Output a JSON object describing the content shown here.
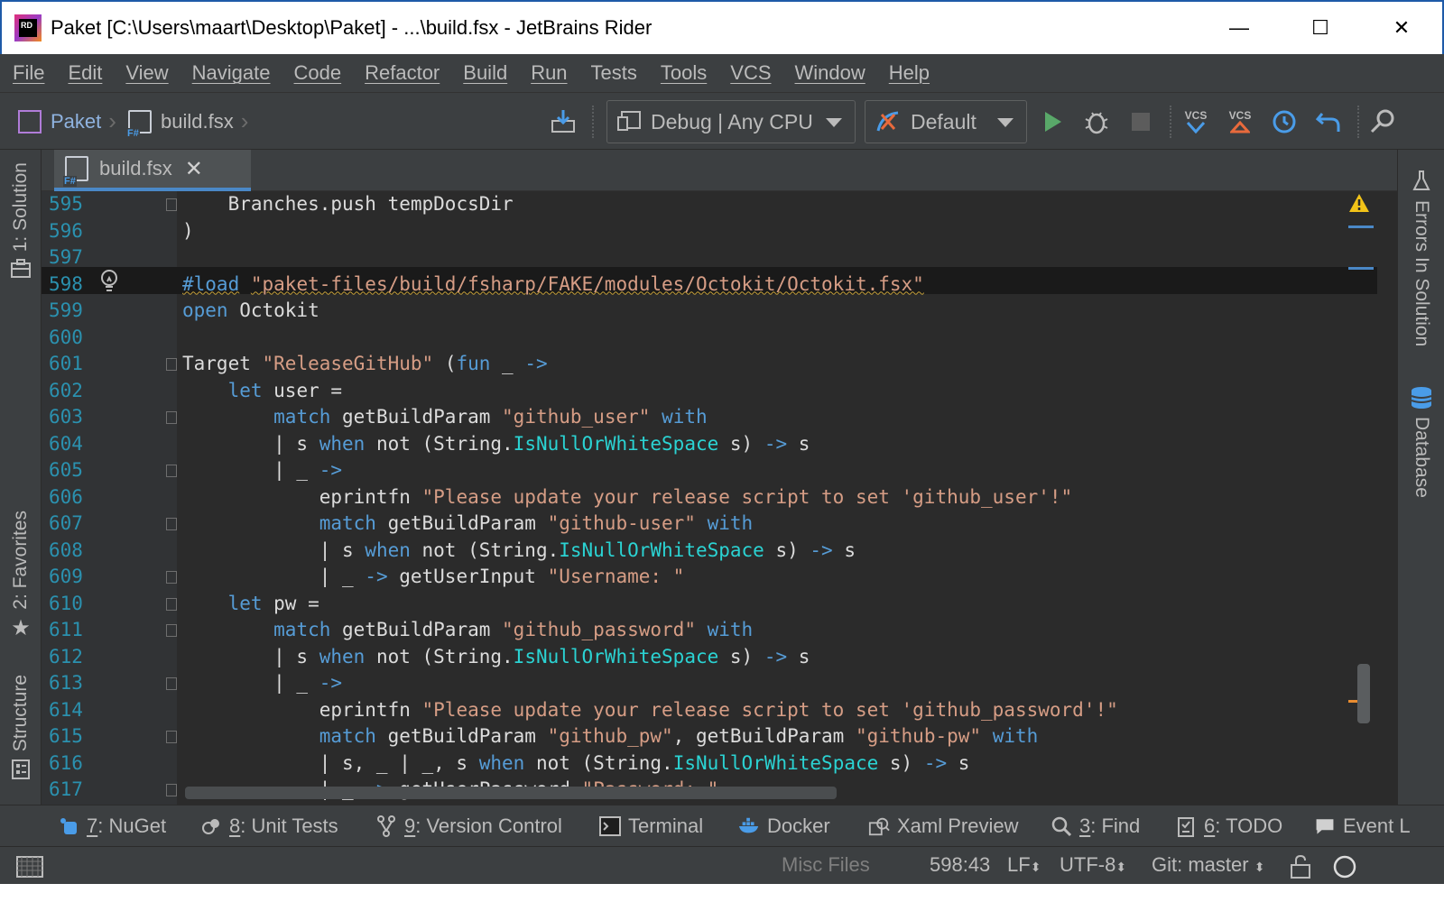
{
  "window": {
    "title": "Paket [C:\\Users\\maart\\Desktop\\Paket] - ...\\build.fsx - JetBrains Rider",
    "logo_text": "RD",
    "minimize": "—",
    "maximize": "☐",
    "close": "✕"
  },
  "menu": [
    "File",
    "Edit",
    "View",
    "Navigate",
    "Code",
    "Refactor",
    "Build",
    "Run",
    "Tests",
    "Tools",
    "VCS",
    "Window",
    "Help"
  ],
  "breadcrumb": {
    "project": "Paket",
    "file": "build.fsx",
    "sep": "›"
  },
  "toolbar": {
    "config": "Debug | Any CPU",
    "run_config": "Default",
    "vcs_update_label": "VCS",
    "vcs_commit_label": "VCS"
  },
  "left_tools": {
    "solution": "1: Solution",
    "favorites": "2: Favorites",
    "structure": "Structure"
  },
  "right_tools": {
    "errors": "Errors In Solution",
    "database": "Database"
  },
  "tab": {
    "label": "build.fsx",
    "close": "✕"
  },
  "editor": {
    "lines": [
      {
        "n": "595",
        "tokens": [
          {
            "t": "    ",
            "c": "pl"
          },
          {
            "t": "Branches.push tempDocsDir",
            "c": "pl"
          }
        ]
      },
      {
        "n": "596",
        "tokens": [
          {
            "t": ")",
            "c": "pl"
          }
        ]
      },
      {
        "n": "597",
        "tokens": []
      },
      {
        "n": "598",
        "tokens": [
          {
            "t": "#load",
            "c": "dir"
          },
          {
            "t": " ",
            "c": "pl"
          },
          {
            "t": "\"paket-files/build/fsharp/FAKE/modules/Octokit/Octokit.fsx\"",
            "c": "dirstr"
          }
        ]
      },
      {
        "n": "599",
        "tokens": [
          {
            "t": "open",
            "c": "kw"
          },
          {
            "t": " Octokit",
            "c": "pl"
          }
        ]
      },
      {
        "n": "600",
        "tokens": []
      },
      {
        "n": "601",
        "tokens": [
          {
            "t": "Target ",
            "c": "pl"
          },
          {
            "t": "\"ReleaseGitHub\"",
            "c": "str"
          },
          {
            "t": " (",
            "c": "pl"
          },
          {
            "t": "fun",
            "c": "kw"
          },
          {
            "t": " _ ",
            "c": "pl"
          },
          {
            "t": "->",
            "c": "kw"
          }
        ]
      },
      {
        "n": "602",
        "tokens": [
          {
            "t": "    ",
            "c": "pl"
          },
          {
            "t": "let",
            "c": "kw"
          },
          {
            "t": " user =",
            "c": "pl"
          }
        ]
      },
      {
        "n": "603",
        "tokens": [
          {
            "t": "        ",
            "c": "pl"
          },
          {
            "t": "match",
            "c": "kw"
          },
          {
            "t": " getBuildParam ",
            "c": "pl"
          },
          {
            "t": "\"github_user\"",
            "c": "str"
          },
          {
            "t": " ",
            "c": "pl"
          },
          {
            "t": "with",
            "c": "kw"
          }
        ]
      },
      {
        "n": "604",
        "tokens": [
          {
            "t": "        | s ",
            "c": "pl"
          },
          {
            "t": "when",
            "c": "kw"
          },
          {
            "t": " not (String.",
            "c": "pl"
          },
          {
            "t": "IsNullOrWhiteSpace",
            "c": "typ"
          },
          {
            "t": " s) ",
            "c": "pl"
          },
          {
            "t": "->",
            "c": "kw"
          },
          {
            "t": " s",
            "c": "pl"
          }
        ]
      },
      {
        "n": "605",
        "tokens": [
          {
            "t": "        | _ ",
            "c": "pl"
          },
          {
            "t": "->",
            "c": "kw"
          }
        ]
      },
      {
        "n": "606",
        "tokens": [
          {
            "t": "            eprintfn ",
            "c": "pl"
          },
          {
            "t": "\"Please update your release script to set 'github_user'!\"",
            "c": "str"
          }
        ]
      },
      {
        "n": "607",
        "tokens": [
          {
            "t": "            ",
            "c": "pl"
          },
          {
            "t": "match",
            "c": "kw"
          },
          {
            "t": " getBuildParam ",
            "c": "pl"
          },
          {
            "t": "\"github-user\"",
            "c": "str"
          },
          {
            "t": " ",
            "c": "pl"
          },
          {
            "t": "with",
            "c": "kw"
          }
        ]
      },
      {
        "n": "608",
        "tokens": [
          {
            "t": "            | s ",
            "c": "pl"
          },
          {
            "t": "when",
            "c": "kw"
          },
          {
            "t": " not (String.",
            "c": "pl"
          },
          {
            "t": "IsNullOrWhiteSpace",
            "c": "typ"
          },
          {
            "t": " s) ",
            "c": "pl"
          },
          {
            "t": "->",
            "c": "kw"
          },
          {
            "t": " s",
            "c": "pl"
          }
        ]
      },
      {
        "n": "609",
        "tokens": [
          {
            "t": "            | _ ",
            "c": "pl"
          },
          {
            "t": "->",
            "c": "kw"
          },
          {
            "t": " getUserInput ",
            "c": "pl"
          },
          {
            "t": "\"Username: \"",
            "c": "str"
          }
        ]
      },
      {
        "n": "610",
        "tokens": [
          {
            "t": "    ",
            "c": "pl"
          },
          {
            "t": "let",
            "c": "kw"
          },
          {
            "t": " pw =",
            "c": "pl"
          }
        ]
      },
      {
        "n": "611",
        "tokens": [
          {
            "t": "        ",
            "c": "pl"
          },
          {
            "t": "match",
            "c": "kw"
          },
          {
            "t": " getBuildParam ",
            "c": "pl"
          },
          {
            "t": "\"github_password\"",
            "c": "str"
          },
          {
            "t": " ",
            "c": "pl"
          },
          {
            "t": "with",
            "c": "kw"
          }
        ]
      },
      {
        "n": "612",
        "tokens": [
          {
            "t": "        | s ",
            "c": "pl"
          },
          {
            "t": "when",
            "c": "kw"
          },
          {
            "t": " not (String.",
            "c": "pl"
          },
          {
            "t": "IsNullOrWhiteSpace",
            "c": "typ"
          },
          {
            "t": " s) ",
            "c": "pl"
          },
          {
            "t": "->",
            "c": "kw"
          },
          {
            "t": " s",
            "c": "pl"
          }
        ]
      },
      {
        "n": "613",
        "tokens": [
          {
            "t": "        | _ ",
            "c": "pl"
          },
          {
            "t": "->",
            "c": "kw"
          }
        ]
      },
      {
        "n": "614",
        "tokens": [
          {
            "t": "            eprintfn ",
            "c": "pl"
          },
          {
            "t": "\"Please update your release script to set 'github_password'!\"",
            "c": "str"
          }
        ]
      },
      {
        "n": "615",
        "tokens": [
          {
            "t": "            ",
            "c": "pl"
          },
          {
            "t": "match",
            "c": "kw"
          },
          {
            "t": " getBuildParam ",
            "c": "pl"
          },
          {
            "t": "\"github_pw\"",
            "c": "str"
          },
          {
            "t": ", getBuildParam ",
            "c": "pl"
          },
          {
            "t": "\"github-pw\"",
            "c": "str"
          },
          {
            "t": " ",
            "c": "pl"
          },
          {
            "t": "with",
            "c": "kw"
          }
        ]
      },
      {
        "n": "616",
        "tokens": [
          {
            "t": "            | s, _ | _, s ",
            "c": "pl"
          },
          {
            "t": "when",
            "c": "kw"
          },
          {
            "t": " not (String.",
            "c": "pl"
          },
          {
            "t": "IsNullOrWhiteSpace",
            "c": "typ"
          },
          {
            "t": " s) ",
            "c": "pl"
          },
          {
            "t": "->",
            "c": "kw"
          },
          {
            "t": " s",
            "c": "pl"
          }
        ]
      },
      {
        "n": "617",
        "tokens": [
          {
            "t": "            | _ ",
            "c": "pl"
          },
          {
            "t": "->",
            "c": "kw"
          },
          {
            "t": " getUserPassword ",
            "c": "pl"
          },
          {
            "t": "\"Password: \"",
            "c": "str"
          }
        ]
      }
    ]
  },
  "bottom_tools": [
    {
      "key": "7",
      "label": ": NuGet",
      "icon": "nuget-icon"
    },
    {
      "key": "8",
      "label": ": Unit Tests",
      "icon": "unit-tests-icon"
    },
    {
      "key": "9",
      "label": ": Version Control",
      "icon": "version-control-icon"
    },
    {
      "key": "",
      "label": "Terminal",
      "icon": "terminal-icon"
    },
    {
      "key": "",
      "label": "Docker",
      "icon": "docker-icon"
    },
    {
      "key": "",
      "label": "Xaml Preview",
      "icon": "xaml-preview-icon"
    },
    {
      "key": "3",
      "label": ": Find",
      "icon": "find-icon"
    },
    {
      "key": "6",
      "label": ": TODO",
      "icon": "todo-icon"
    },
    {
      "key": "",
      "label": "Event L",
      "icon": "event-log-icon"
    }
  ],
  "status": {
    "context": "Misc Files",
    "position": "598:43",
    "line_sep": "LF",
    "encoding": "UTF-8",
    "git": "Git: master"
  },
  "colors": {
    "accent": "#4a88c7",
    "keyword": "#569cd6",
    "string": "#d69d85",
    "type": "#2bd3d3",
    "line_number": "#2b91af"
  }
}
